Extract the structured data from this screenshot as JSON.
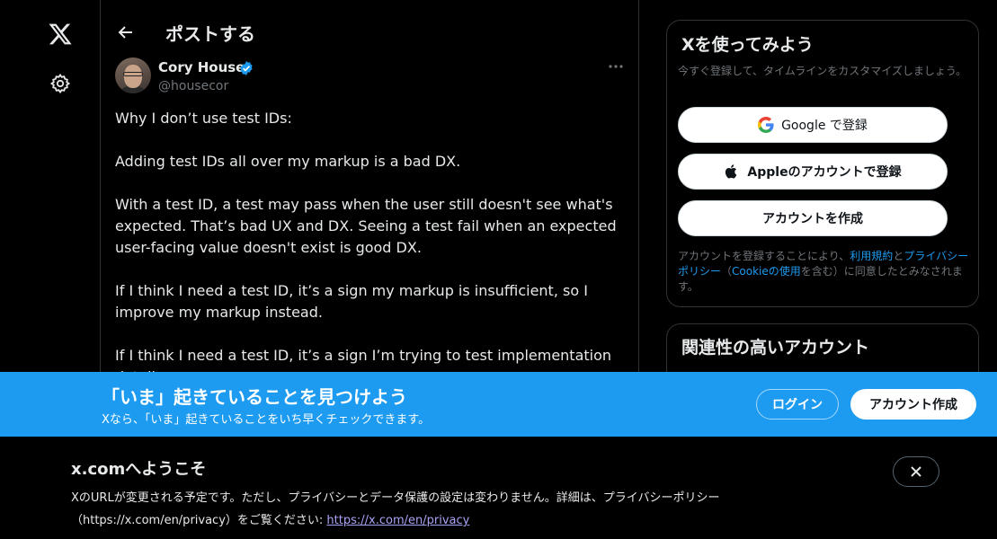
{
  "nav": {
    "logo_icon": "x-logo-icon",
    "settings_icon": "gear-icon"
  },
  "header": {
    "title": "ポストする"
  },
  "post": {
    "author_name": "Cory House",
    "author_handle": "@housecor",
    "verified": true,
    "paragraphs": [
      "Why I don’t use test IDs:",
      "Adding test IDs all over my markup is a bad DX.",
      "With a test ID, a test may pass when the user still doesn't see what's expected. That’s bad UX and DX. Seeing a test fail when an expected user-facing value doesn't exist is good DX.",
      "If I think I need a test ID, it’s a sign my markup is insufficient, so I improve my markup instead.",
      "If I think I need a test ID, it’s a sign I’m trying to test implementation details"
    ]
  },
  "signup_panel": {
    "title": "Xを使ってみよう",
    "subtitle": "今すぐ登録して、タイムラインをカスタマイズしましょう。",
    "google_button": "Google で登録",
    "apple_button": "Appleのアカウントで登録",
    "create_button": "アカウントを作成",
    "legal_prefix": "アカウントを登録することにより、",
    "legal_terms": "利用規約",
    "legal_and": "と",
    "legal_privacy": "プライバシーポリシー",
    "legal_open": "（",
    "legal_cookie": "Cookieの使用",
    "legal_suffix": "を含む）に同意したとみなされます。"
  },
  "related": {
    "title": "関連性の高いアカウント"
  },
  "banner": {
    "title": "「いま」起きていることを見つけよう",
    "subtitle": "Xなら、「いま」起きていることをいち早くチェックできます。",
    "login": "ログイン",
    "signup": "アカウント作成",
    "color": "#1d9bf0"
  },
  "notice": {
    "title": "x.comへようこそ",
    "body": "XのURLが変更される予定です。ただし、プライバシーとデータ保護の設定は変わりません。詳細は、プライバシーポリシー（https://x.com/en/privacy）をご覧ください: ",
    "link": "https://x.com/en/privacy"
  }
}
